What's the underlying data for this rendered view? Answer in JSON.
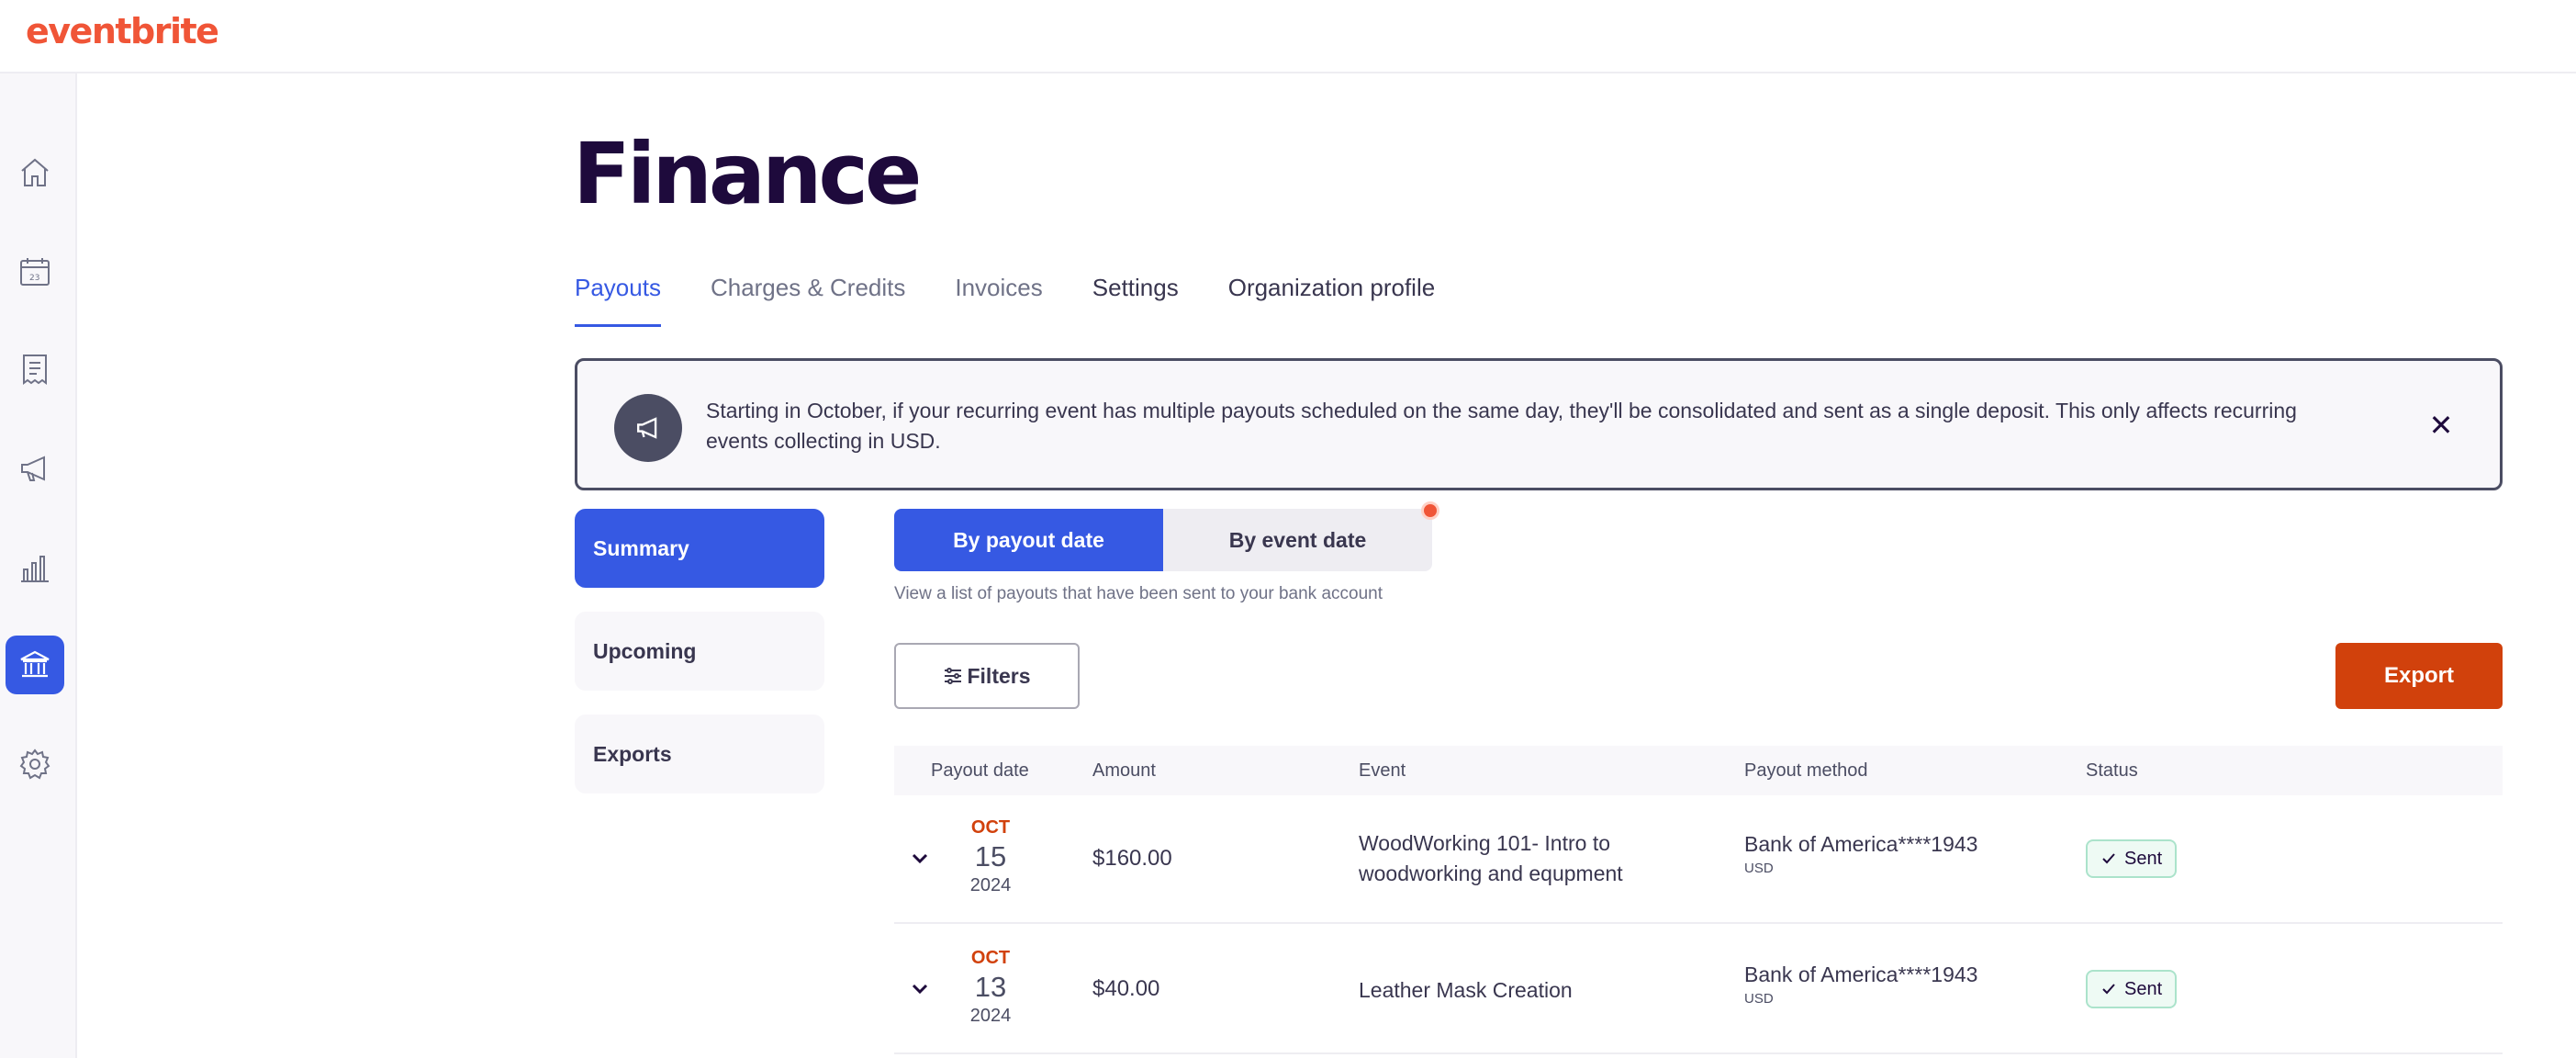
{
  "brand": {
    "logo_text": "eventbrite",
    "accent": "#3659e3",
    "logo_color": "#f05537",
    "export_color": "#d1410c"
  },
  "sidenav": [
    {
      "name": "home-icon",
      "active": false
    },
    {
      "name": "calendar-icon",
      "active": false
    },
    {
      "name": "orders-icon",
      "active": false
    },
    {
      "name": "marketing-icon",
      "active": false
    },
    {
      "name": "reports-icon",
      "active": false
    },
    {
      "name": "finance-bank-icon",
      "active": true
    },
    {
      "name": "settings-icon",
      "active": false
    }
  ],
  "page": {
    "title": "Finance"
  },
  "tabs": [
    {
      "label": "Payouts",
      "active": true
    },
    {
      "label": "Charges & Credits",
      "active": false
    },
    {
      "label": "Invoices",
      "active": false
    },
    {
      "label": "Settings",
      "active": false
    },
    {
      "label": "Organization profile",
      "active": false
    }
  ],
  "banner": {
    "text": "Starting in October, if your recurring event has multiple payouts scheduled on the same day, they'll be consolidated and sent as a single deposit. This only affects recurring events collecting in USD.",
    "icon": "megaphone-icon",
    "close_label": "✕"
  },
  "subnav": [
    {
      "label": "Summary",
      "active": true
    },
    {
      "label": "Upcoming",
      "active": false
    },
    {
      "label": "Exports",
      "active": false
    }
  ],
  "view_toggle": {
    "by_payout_date": "By payout date",
    "by_event_date": "By event date",
    "selected": "by_payout_date"
  },
  "hint": "View a list of payouts that have been sent to your bank account",
  "filters_label": "Filters",
  "export_label": "Export",
  "table": {
    "columns": [
      "Payout date",
      "Amount",
      "Event",
      "Payout method",
      "Status"
    ],
    "rows": [
      {
        "month": "OCT",
        "day": "15",
        "year": "2024",
        "amount": "$160.00",
        "event": "WoodWorking 101- Intro to woodworking and equpment",
        "method": "Bank of America****1943",
        "currency": "USD",
        "status": "Sent"
      },
      {
        "month": "OCT",
        "day": "13",
        "year": "2024",
        "amount": "$40.00",
        "event": "Leather Mask Creation",
        "method": "Bank of America****1943",
        "currency": "USD",
        "status": "Sent"
      }
    ]
  }
}
